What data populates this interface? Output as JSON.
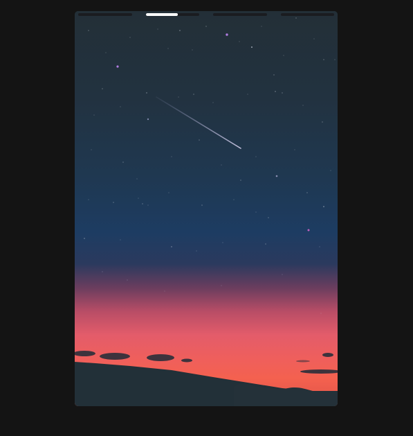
{
  "viewer": {
    "background_color": "#141414",
    "story": {
      "total_segments": 4,
      "active_segment": 2,
      "segments": [
        {
          "progress": 0.0
        },
        {
          "progress": 0.6
        },
        {
          "progress": 0.0
        },
        {
          "progress": 0.0
        }
      ],
      "colors": {
        "bar_track": "#1a1c20",
        "bar_fill": "#ffffff"
      },
      "image": {
        "subject": "night-sky-shooting-star-sunset",
        "colors": {
          "sky_top": "#233038",
          "sky_blue": "#1d3a5c",
          "horizon_pink": "#e0606e",
          "horizon_red": "#f15850",
          "ground": "#223038"
        }
      }
    }
  }
}
